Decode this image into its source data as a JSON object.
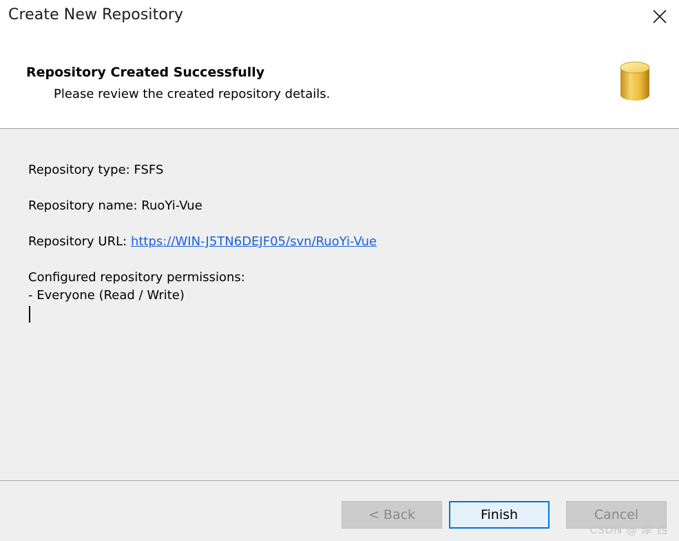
{
  "window": {
    "title": "Create New Repository"
  },
  "header": {
    "title": "Repository Created Successfully",
    "subtitle": "Please review the created repository details.",
    "icon": "database-icon"
  },
  "details": {
    "type_label": "Repository type: ",
    "type_value": "FSFS",
    "name_label": "Repository name: ",
    "name_value": "RuoYi-Vue",
    "url_label": "Repository URL: ",
    "url_value": "https://WIN-J5TN6DEJF05/svn/RuoYi-Vue",
    "permissions_label": "Configured repository permissions:",
    "permissions_item": "- Everyone (Read / Write)"
  },
  "footer": {
    "back_label": "< Back",
    "finish_label": "Finish",
    "cancel_label": "Cancel"
  },
  "watermark": "CSDN @ 摩 西",
  "colors": {
    "link": "#1a5fd8",
    "content_bg": "#efefef",
    "focus_border": "#0078d7"
  }
}
